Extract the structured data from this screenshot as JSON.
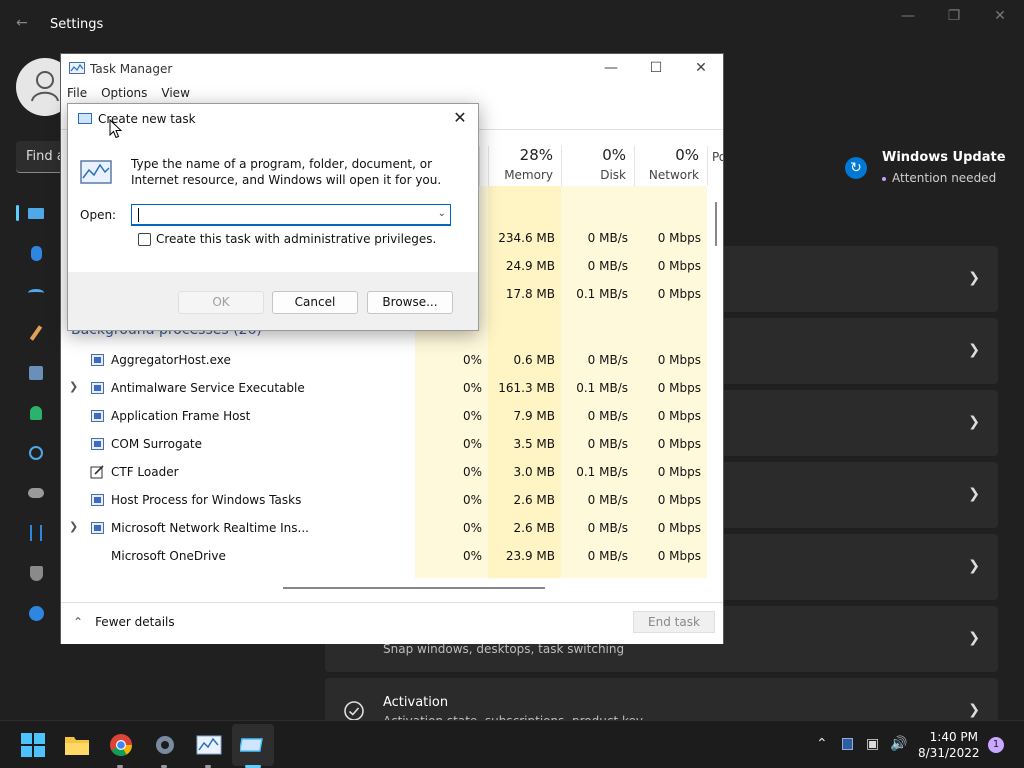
{
  "settings": {
    "title": "Settings",
    "search_placeholder": "Find a",
    "windows_update": {
      "title": "Windows Update",
      "status": "Attention needed"
    },
    "cards": [
      {
        "label": "",
        "sub": ""
      },
      {
        "label": "",
        "sub": ""
      },
      {
        "label": "",
        "sub": ""
      },
      {
        "label": "",
        "sub": ""
      },
      {
        "label": "",
        "sub": ""
      },
      {
        "label": "",
        "sub": "Snap windows, desktops, task switching"
      },
      {
        "label": "Activation",
        "sub": "Activation state, subscriptions, product key"
      }
    ]
  },
  "task_manager": {
    "title": "Task Manager",
    "menu": [
      "File",
      "Options",
      "View"
    ],
    "columns": [
      {
        "pct": "28%",
        "label": "Memory"
      },
      {
        "pct": "0%",
        "label": "Disk"
      },
      {
        "pct": "0%",
        "label": "Network"
      },
      {
        "pct": "",
        "label": "Po"
      }
    ],
    "apps_rows": [
      {
        "memory": "234.6 MB",
        "disk": "0 MB/s",
        "network": "0 Mbps"
      },
      {
        "memory": "24.9 MB",
        "disk": "0 MB/s",
        "network": "0 Mbps"
      },
      {
        "memory": "17.8 MB",
        "disk": "0.1 MB/s",
        "network": "0 Mbps"
      }
    ],
    "background_header": "Background processes (26)",
    "processes": [
      {
        "name": "AggregatorHost.exe",
        "expand": false,
        "cpu": "0%",
        "memory": "0.6 MB",
        "disk": "0 MB/s",
        "network": "0 Mbps"
      },
      {
        "name": "Antimalware Service Executable",
        "expand": true,
        "cpu": "0%",
        "memory": "161.3 MB",
        "disk": "0.1 MB/s",
        "network": "0 Mbps"
      },
      {
        "name": "Application Frame Host",
        "expand": false,
        "cpu": "0%",
        "memory": "7.9 MB",
        "disk": "0 MB/s",
        "network": "0 Mbps"
      },
      {
        "name": "COM Surrogate",
        "expand": false,
        "cpu": "0%",
        "memory": "3.5 MB",
        "disk": "0 MB/s",
        "network": "0 Mbps"
      },
      {
        "name": "CTF Loader",
        "expand": false,
        "cpu": "0%",
        "memory": "3.0 MB",
        "disk": "0.1 MB/s",
        "network": "0 Mbps"
      },
      {
        "name": "Host Process for Windows Tasks",
        "expand": false,
        "cpu": "0%",
        "memory": "2.6 MB",
        "disk": "0 MB/s",
        "network": "0 Mbps"
      },
      {
        "name": "Microsoft Network Realtime Ins...",
        "expand": true,
        "cpu": "0%",
        "memory": "2.6 MB",
        "disk": "0 MB/s",
        "network": "0 Mbps"
      },
      {
        "name": "Microsoft OneDrive",
        "expand": false,
        "cpu": "0%",
        "memory": "23.9 MB",
        "disk": "0 MB/s",
        "network": "0 Mbps"
      }
    ],
    "fewer_details": "Fewer details",
    "end_task": "End task"
  },
  "dialog": {
    "title": "Create new task",
    "message": "Type the name of a program, folder, document, or Internet resource, and Windows will open it for you.",
    "open_label": "Open:",
    "open_value": "",
    "admin_checkbox_label": "Create this task with administrative privileges.",
    "ok": "OK",
    "cancel": "Cancel",
    "browse": "Browse..."
  },
  "taskbar": {
    "time": "1:40 PM",
    "date": "8/31/2022",
    "notifications": "1"
  },
  "colors": {
    "accent": "#0067c0",
    "heat_light": "#fff9dc",
    "heat_mid": "#fff4c4",
    "settings_bg": "#202020",
    "card_bg": "#2b2b2b"
  }
}
